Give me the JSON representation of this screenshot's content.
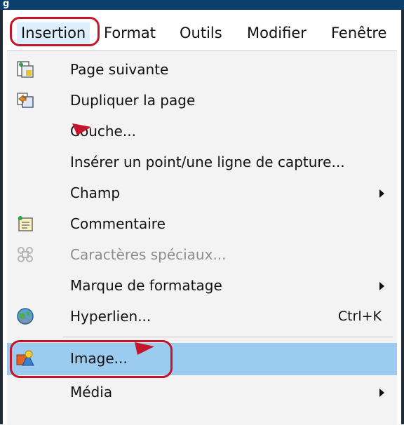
{
  "window": {
    "title_fragment": "g"
  },
  "menubar": {
    "items": [
      {
        "label": "Insertion"
      },
      {
        "label": "Format"
      },
      {
        "label": "Outils"
      },
      {
        "label": "Modifier"
      },
      {
        "label": "Fenêtre"
      }
    ]
  },
  "menu": {
    "items": [
      {
        "label": "Page suivante",
        "icon": "page-next-icon"
      },
      {
        "label": "Dupliquer la page",
        "icon": "duplicate-page-icon"
      },
      {
        "label": "Couche...",
        "icon": ""
      },
      {
        "label": "Insérer un point/une ligne de capture...",
        "icon": ""
      },
      {
        "label": "Champ",
        "icon": "",
        "submenu": true
      },
      {
        "label": "Commentaire",
        "icon": "comment-icon"
      },
      {
        "label": "Caractères spéciaux...",
        "icon": "special-characters-icon",
        "disabled": true
      },
      {
        "label": "Marque de formatage",
        "icon": "",
        "submenu": true
      },
      {
        "label": "Hyperlien...",
        "icon": "hyperlink-icon",
        "shortcut": "Ctrl+K"
      },
      {
        "label": "Image...",
        "icon": "image-icon",
        "selected": true
      },
      {
        "label": "Média",
        "icon": "",
        "submenu": true
      }
    ]
  },
  "colors": {
    "highlight_outline": "#c4152a",
    "selected_row": "#9ccbf0",
    "annotation_marker": "#c4152a"
  }
}
